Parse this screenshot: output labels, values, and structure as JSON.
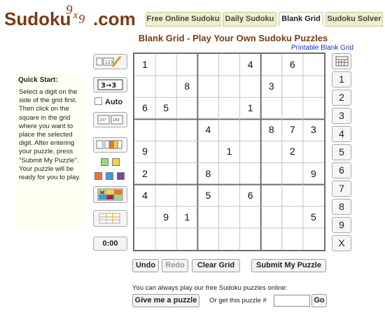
{
  "logo": {
    "left": "Sudoku",
    "mid_top": "9",
    "mid_x": "x",
    "mid_sub": "9",
    "right": ".com"
  },
  "nav": {
    "tabs": [
      {
        "label": "Free Online Sudoku"
      },
      {
        "label": "Daily Sudoku"
      },
      {
        "label": "Blank Grid"
      },
      {
        "label": "Sudoku Solver"
      }
    ],
    "active": "Blank Grid"
  },
  "page": {
    "title": "Blank Grid - Play Your Own Sudoku Puzzles",
    "printable_link": "Printable Blank Grid"
  },
  "quick_start": {
    "title": "Quick Start:",
    "text": "Select a digit on the side of the grid first. Then click on the square in the grid where you want to place the selected digit. After entering your puzzle, press \"Submit My Puzzle\". Your puzzle will be ready for you to play."
  },
  "tools": {
    "auto_label": "Auto",
    "timer": "0:00",
    "swatch_colors": [
      "#9bd97b",
      "#f2d34b",
      "#e8752a",
      "#3c9be0",
      "#7a4a9c"
    ]
  },
  "grid": {
    "rows": [
      [
        "1",
        "",
        "",
        "",
        "",
        "4",
        "",
        "6",
        ""
      ],
      [
        "",
        "",
        "8",
        "",
        "",
        "",
        "3",
        "",
        ""
      ],
      [
        "6",
        "5",
        "",
        "",
        "",
        "1",
        "",
        "",
        ""
      ],
      [
        "",
        "",
        "",
        "4",
        "",
        "",
        "8",
        "7",
        "3"
      ],
      [
        "9",
        "",
        "",
        "",
        "1",
        "",
        "",
        "2",
        ""
      ],
      [
        "2",
        "",
        "",
        "8",
        "",
        "",
        "",
        "",
        "9"
      ],
      [
        "4",
        "",
        "",
        "5",
        "",
        "6",
        "",
        "",
        ""
      ],
      [
        "",
        "9",
        "1",
        "",
        "",
        "",
        "",
        "",
        "5"
      ],
      [
        "",
        "",
        "",
        "",
        "",
        "",
        "",
        "",
        ""
      ]
    ]
  },
  "keypad": {
    "keys": [
      "1",
      "2",
      "3",
      "4",
      "5",
      "6",
      "7",
      "8",
      "9",
      "X"
    ]
  },
  "actions": {
    "undo": "Undo",
    "redo": "Redo",
    "clear": "Clear Grid",
    "submit": "Submit My Puzzle"
  },
  "footer": {
    "text": "You can always play our free Sudoku puzzles online:",
    "give_button": "Give me a puzzle",
    "or_text": "Or get this puzzle #",
    "go_button": "Go",
    "puzzle_input": ""
  }
}
